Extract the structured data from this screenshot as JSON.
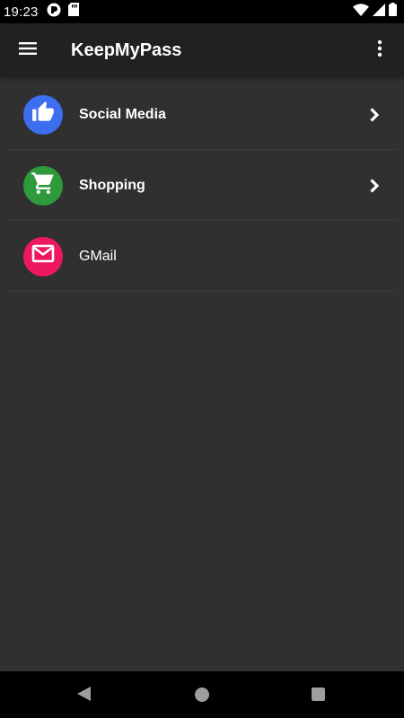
{
  "status_bar": {
    "time": "19:23",
    "left_icons": [
      "app-notification-icon",
      "sd-card-icon"
    ],
    "right_icons": [
      "wifi-icon",
      "cellular-signal-icon",
      "battery-icon"
    ]
  },
  "app_bar": {
    "title": "KeepMyPass",
    "nav_icon": "menu-icon",
    "action_icon": "more-vert-icon"
  },
  "categories": [
    {
      "label": "Social Media",
      "icon": "thumbs-up-icon",
      "color": "#3d6ef0",
      "has_children": true,
      "bold": true
    },
    {
      "label": "Shopping",
      "icon": "shopping-cart-icon",
      "color": "#2e9a3c",
      "has_children": true,
      "bold": true
    },
    {
      "label": "GMail",
      "icon": "mail-icon",
      "color": "#ee1860",
      "has_children": false,
      "bold": false
    }
  ],
  "nav_bar": {
    "buttons": [
      "back-icon",
      "home-icon",
      "recents-icon"
    ]
  },
  "colors": {
    "background": "#303030",
    "app_bar": "#212121",
    "status_bar": "#000000",
    "divider": "#3c3c3c"
  }
}
